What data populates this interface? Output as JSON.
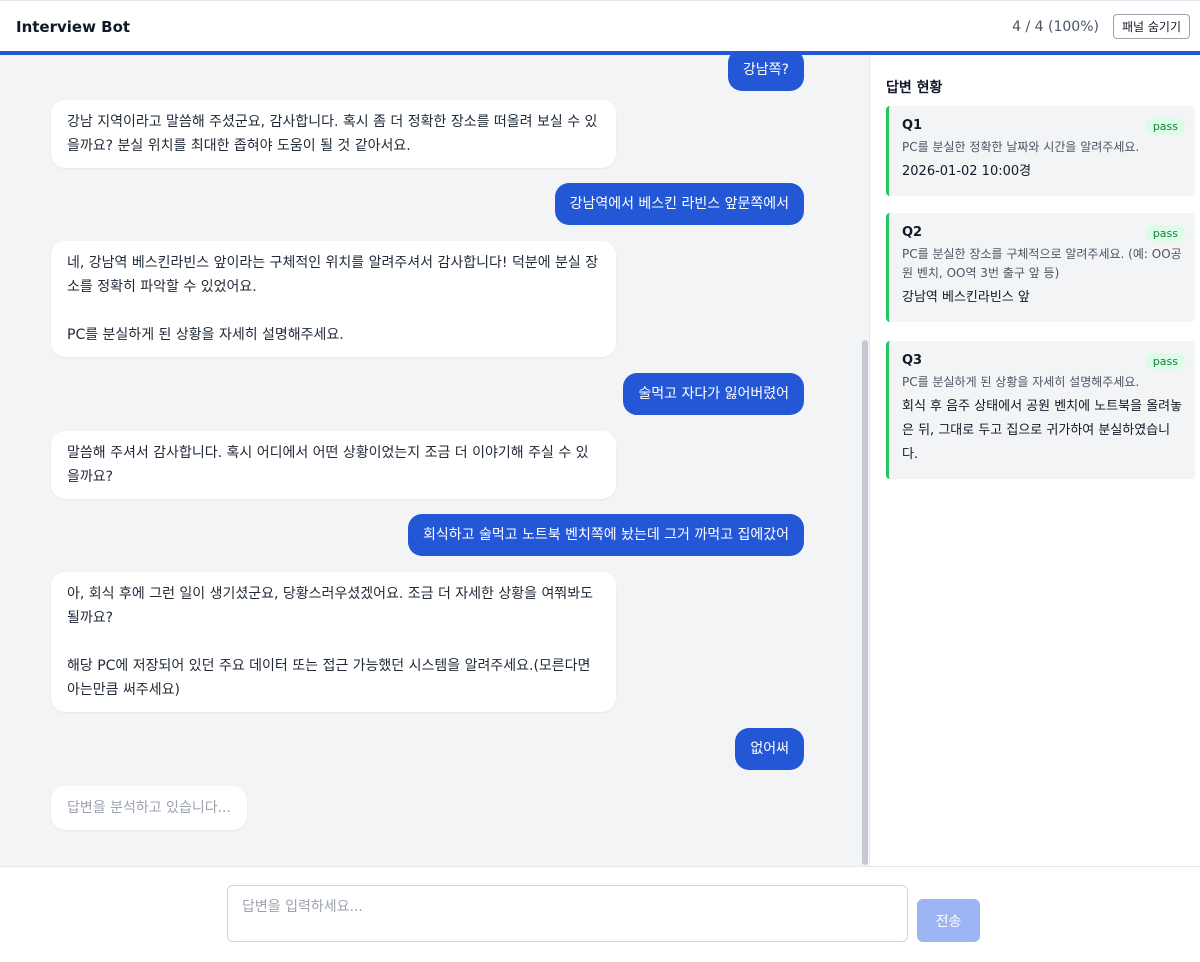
{
  "header": {
    "title": "Interview Bot",
    "progress": "4 / 4 (100%)",
    "toggle_label": "패널 숨기기"
  },
  "chat": {
    "messages": [
      {
        "role": "user",
        "text": "강남쪽?"
      },
      {
        "role": "bot",
        "text": "강남 지역이라고 말씀해 주셨군요, 감사합니다. 혹시 좀 더 정확한 장소를 떠올려 보실 수 있\n을까요? 분실 위치를 최대한 좁혀야 도움이 될 것 같아서요."
      },
      {
        "role": "user",
        "text": "강남역에서 베스킨 라빈스 앞문쪽에서"
      },
      {
        "role": "bot",
        "text": "네, 강남역 베스킨라빈스 앞이라는 구체적인 위치를 알려주셔서 감사합니다! 덕분에 분실 장\n소를 정확히 파악할 수 있었어요.\n\nPC를 분실하게 된 상황을 자세히 설명해주세요."
      },
      {
        "role": "user",
        "text": "술먹고 자다가 잃어버렸어"
      },
      {
        "role": "bot",
        "text": "말씀해 주셔서 감사합니다. 혹시 어디에서 어떤 상황이었는지 조금 더 이야기해 주실 수 있\n을까요?"
      },
      {
        "role": "user",
        "text": "회식하고 술먹고 노트북 벤치쪽에 놨는데 그거 까먹고 집에갔어"
      },
      {
        "role": "bot",
        "text": "아, 회식 후에 그런 일이 생기셨군요, 당황스러우셨겠어요. 조금 더 자세한 상황을 여쭤봐도\n될까요?\n\n해당 PC에 저장되어 있던 주요 데이터 또는 접근 가능했던 시스템을 알려주세요.(모른다면\n아는만큼 써주세요)"
      },
      {
        "role": "user",
        "text": "없어써"
      }
    ],
    "typing_indicator": "답변을 분석하고 있습니다..."
  },
  "panel": {
    "title": "답변 현황",
    "questions": [
      {
        "id": "Q1",
        "status": "pass",
        "question": "PC를 분실한 정확한 날짜와 시간을 알려주세요.",
        "answer": "2026-01-02 10:00경"
      },
      {
        "id": "Q2",
        "status": "pass",
        "question": "PC를 분실한 장소를 구체적으로 알려주세요. (예: OO공원 벤치, OO역 3번 출구 앞 등)",
        "answer": "강남역 베스킨라빈스 앞"
      },
      {
        "id": "Q3",
        "status": "pass",
        "question": "PC를 분실하게 된 상황을 자세히 설명해주세요.",
        "answer": "회식 후 음주 상태에서 공원 벤치에 노트북을 올려놓은 뒤, 그대로 두고 집으로 귀가하여 분실하였습니다."
      }
    ]
  },
  "composer": {
    "placeholder": "답변을 입력하세요...",
    "send_label": "전송"
  },
  "colors": {
    "accent": "#2457d6",
    "pass_border": "#22c55e",
    "send_disabled": "#9db5f2"
  }
}
